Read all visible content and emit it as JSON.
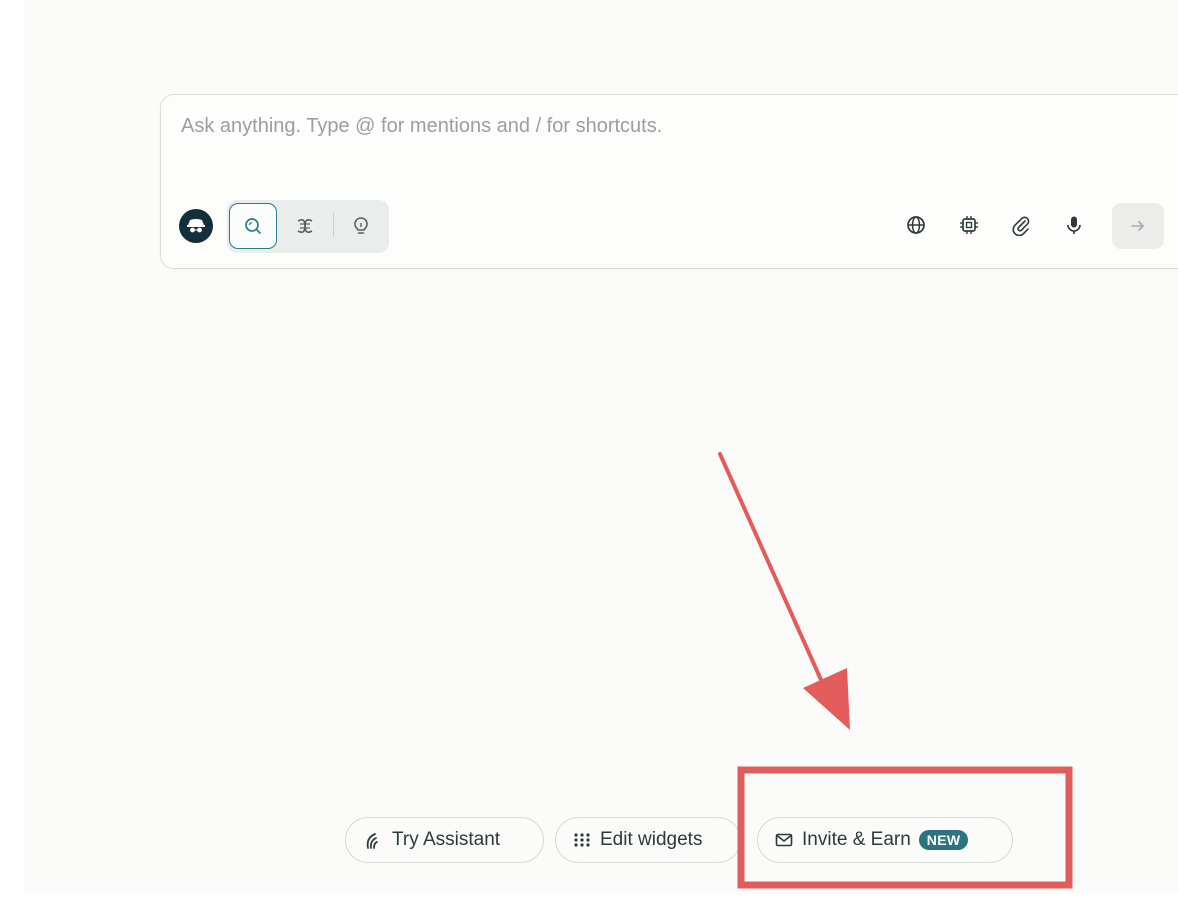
{
  "ask_box": {
    "placeholder": "Ask anything. Type @ for mentions and / for shortcuts.",
    "value": ""
  },
  "toolbar": {
    "avatar_icon": "incognito-avatar-icon",
    "modes": [
      {
        "icon": "search-icon",
        "active": true
      },
      {
        "icon": "research-icon",
        "active": false
      },
      {
        "icon": "lightbulb-icon",
        "active": false
      }
    ],
    "tools": [
      {
        "icon": "globe-icon"
      },
      {
        "icon": "chip-icon"
      },
      {
        "icon": "paperclip-icon"
      },
      {
        "icon": "microphone-icon"
      }
    ],
    "send_icon": "arrow-right-icon"
  },
  "bottom_actions": {
    "try_assistant": "Try Assistant",
    "edit_widgets": "Edit widgets",
    "invite_earn": "Invite & Earn",
    "invite_badge": "NEW"
  },
  "colors": {
    "page_bg": "#fbfbf9",
    "accent": "#2d7483",
    "annotation": "#e25c5c"
  }
}
